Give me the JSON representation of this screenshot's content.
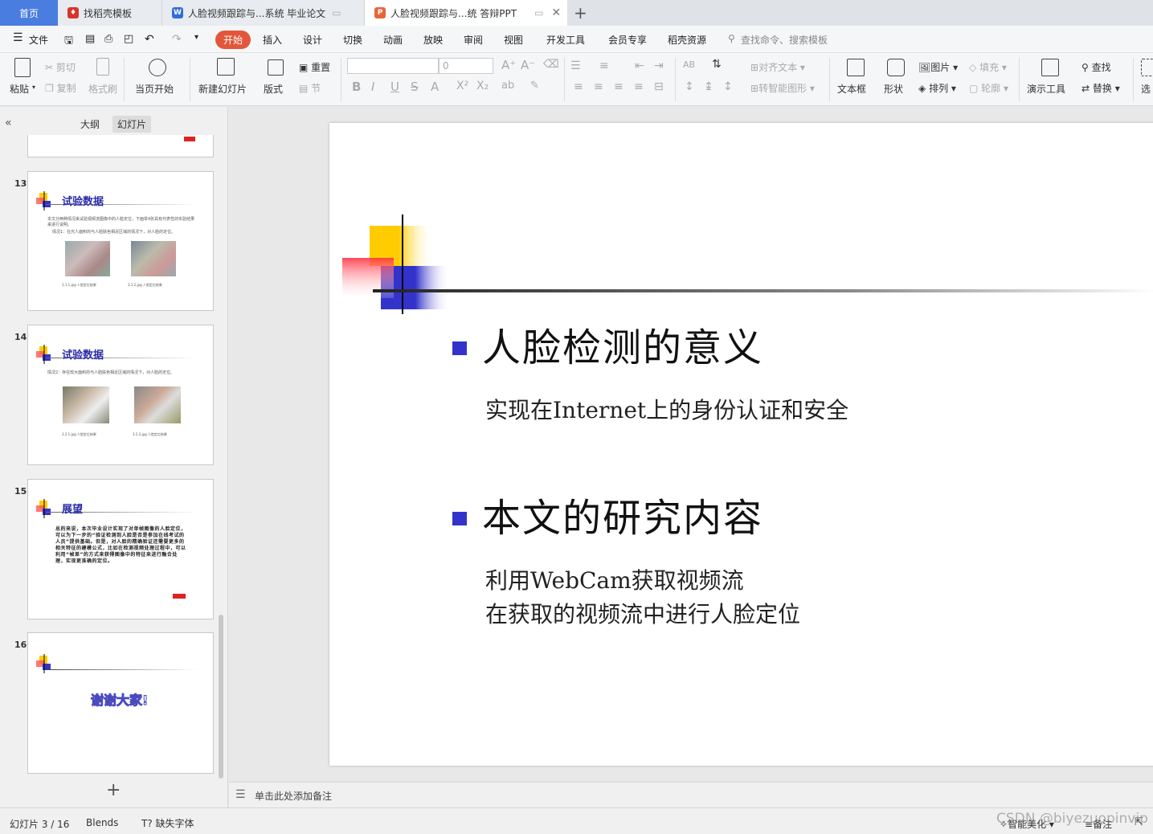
{
  "tabs": [
    {
      "label": "首页",
      "icon": "home-tab"
    },
    {
      "label": "找稻壳模板",
      "icon": "docer-icon"
    },
    {
      "label": "人脸视频跟踪与...系统 毕业论文",
      "icon": "word-doc-icon"
    },
    {
      "label": "人脸视频跟踪与...统 答辩PPT",
      "icon": "ppt-icon"
    }
  ],
  "menu": {
    "file": "文件",
    "items": [
      "开始",
      "插入",
      "设计",
      "切换",
      "动画",
      "放映",
      "审阅",
      "视图",
      "开发工具",
      "会员专享",
      "稻壳资源"
    ],
    "active": "开始",
    "search": "查找命令、搜索模板"
  },
  "ribbon": {
    "paste": "粘贴",
    "cut": "剪切",
    "copy": "复制",
    "format_painter": "格式刷",
    "from_current": "当页开始",
    "new_slide": "新建幻灯片",
    "layout": "版式",
    "reset": "重置",
    "section": "节",
    "font_size": "0",
    "align_text": "对齐文本",
    "smart_art": "转智能图形",
    "textbox": "文本框",
    "shape": "形状",
    "picture": "图片",
    "arrange": "排列",
    "fill": "填充",
    "outline": "轮廓",
    "present_tools": "演示工具",
    "find": "查找",
    "replace": "替换",
    "select": "选"
  },
  "left_panel": {
    "view_outline": "大纲",
    "view_slides": "幻灯片",
    "thumbs": [
      {
        "num": "13",
        "title": "试验数据",
        "text1": "本文分两种情况来试验视频流图像中的人脸定位，下面举4张具有代表性的实验结果来进行说明。",
        "text2": "情况1：在光人面积的与人脸肤色相近区域的情况下，对人脸的定位。",
        "cap1": "3.1.1.jpg 人脸定位结果",
        "cap2": "3.1.2.jpg 人脸定位结果"
      },
      {
        "num": "14",
        "title": "试验数据",
        "text1": "情况2：存在较大面积的与人脸肤色相近区域的情况下，对人脸的定位。",
        "cap1": "3.2.1.jpg 人脸定位结果",
        "cap2": "3.2.2.jpg 人脸定位结果"
      },
      {
        "num": "15",
        "title": "展望",
        "text1": "总的来说，本次毕业设计实现了对单帧图像的人脸定位，可以为下一步的“验证检测到人脸是否是参加在线考试的人员”提供基础。但是，对人脸的精确验证还需要更多的相关特征的建模公式，比如在检测视频处理过程中，可以利用“帧差”的方式来获得图像中的特征来进行融合处理，实现更准确的定位。"
      },
      {
        "num": "16",
        "title": "谢谢大家!"
      }
    ],
    "add_slide": "+"
  },
  "slide": {
    "bullet1": "人脸检测的意义",
    "sub1": "实现在Internet上的身份认证和安全",
    "bullet2": "本文的研究内容",
    "sub2a": "利用WebCam获取视频流",
    "sub2b": "在获取的视频流中进行人脸定位"
  },
  "notes_placeholder": "单击此处添加备注",
  "status": {
    "slide_counter": "幻灯片 3 / 16",
    "theme": "Blends",
    "missing_font": "缺失字体",
    "smart_beautify": "智能美化",
    "notes": "备注",
    "watermark": "CSDN @biyezuopinvip"
  },
  "colors": {
    "accent": "#e2573b",
    "slide_blue": "#3333cc",
    "slide_yellow": "#ffcc00",
    "slide_red": "#ff3333"
  }
}
